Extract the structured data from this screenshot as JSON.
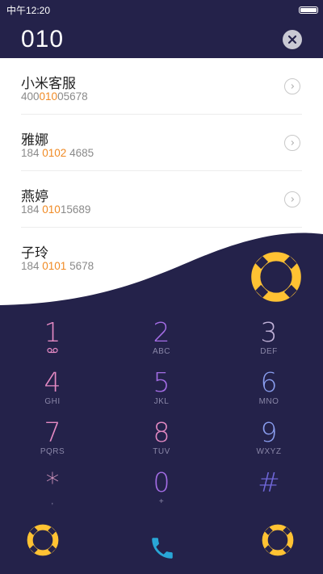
{
  "status_bar": {
    "time": "中午12:20",
    "battery_level": 1.0
  },
  "dialer": {
    "input_value": "010",
    "clear_icon": "close-icon"
  },
  "contacts": [
    {
      "name": "小米客服",
      "number_pre": "400",
      "number_match": "010",
      "number_post": "05678"
    },
    {
      "name": "雅娜",
      "number_pre": "184 ",
      "number_match": "0102",
      "number_post": " 4685"
    },
    {
      "name": "燕婷",
      "number_pre": "184 ",
      "number_match": "010",
      "number_post": "15689"
    },
    {
      "name": "子玲",
      "number_pre": "184 ",
      "number_match": "0101",
      "number_post": " 5678"
    }
  ],
  "keypad": [
    {
      "digit": "1",
      "letters": "",
      "color": "#e58ac4",
      "sub_icon": "voicemail-icon"
    },
    {
      "digit": "2",
      "letters": "ABC",
      "color": "#a46de6"
    },
    {
      "digit": "3",
      "letters": "DEF",
      "color": "#c1b2d8"
    },
    {
      "digit": "4",
      "letters": "GHI",
      "color": "#e58ac4"
    },
    {
      "digit": "5",
      "letters": "JKL",
      "color": "#a46de6"
    },
    {
      "digit": "6",
      "letters": "MNO",
      "color": "#8a9ef0"
    },
    {
      "digit": "7",
      "letters": "PQRS",
      "color": "#e58ac4"
    },
    {
      "digit": "8",
      "letters": "TUV",
      "color": "#e58ac4"
    },
    {
      "digit": "9",
      "letters": "WXYZ",
      "color": "#8a9ef0"
    },
    {
      "digit": "*",
      "letters": ",",
      "color": "#e2a0c8"
    },
    {
      "digit": "0",
      "letters": "+",
      "color": "#a46de6"
    },
    {
      "digit": "#",
      "letters": "",
      "color": "#6f67d8"
    }
  ],
  "colors": {
    "background": "#24224a",
    "highlight": "#f08a24",
    "gear_ring": "#ffc233",
    "call_icon": "#29a6d6"
  },
  "icons": {
    "floating_button": "gear-icon",
    "bottom_left": "gear-icon",
    "bottom_right": "gear-icon",
    "call": "phone-icon",
    "row_action": "chevron-right-icon"
  }
}
